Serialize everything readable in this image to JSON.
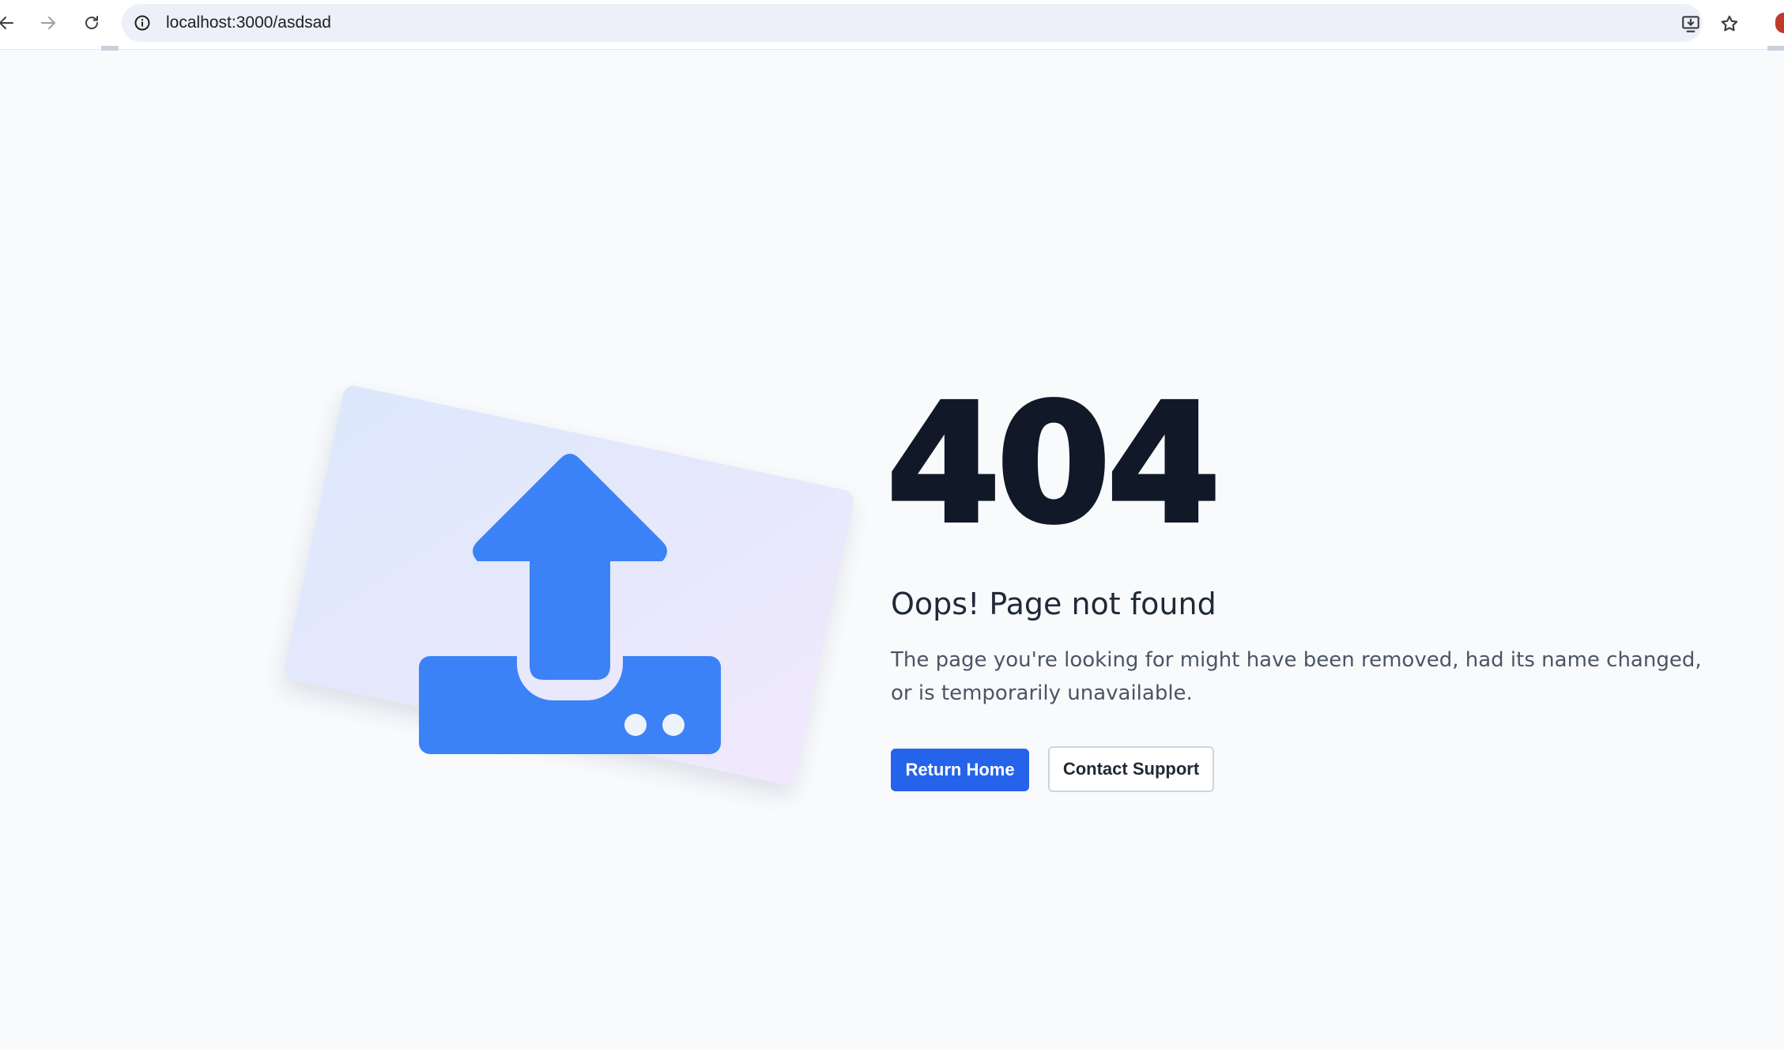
{
  "browser": {
    "url": "localhost:3000/asdsad",
    "icons": {
      "back": "arrow-left-icon",
      "forward": "arrow-right-icon",
      "reload": "reload-icon",
      "site_info": "info-icon",
      "install": "install-app-icon",
      "bookmark": "star-icon"
    }
  },
  "page": {
    "error_code": "404",
    "title": "Oops! Page not found",
    "description": "The page you're looking for might have been removed, had its name changed, or is temporarily unavailable.",
    "primary_button": "Return Home",
    "secondary_button": "Contact Support",
    "illustration": "upload-tray-icon"
  },
  "colors": {
    "background": "#f8fafc",
    "accent": "#2563eb",
    "illustration": "#3b82f6",
    "heading": "#111827",
    "body_text": "#4b5563"
  }
}
